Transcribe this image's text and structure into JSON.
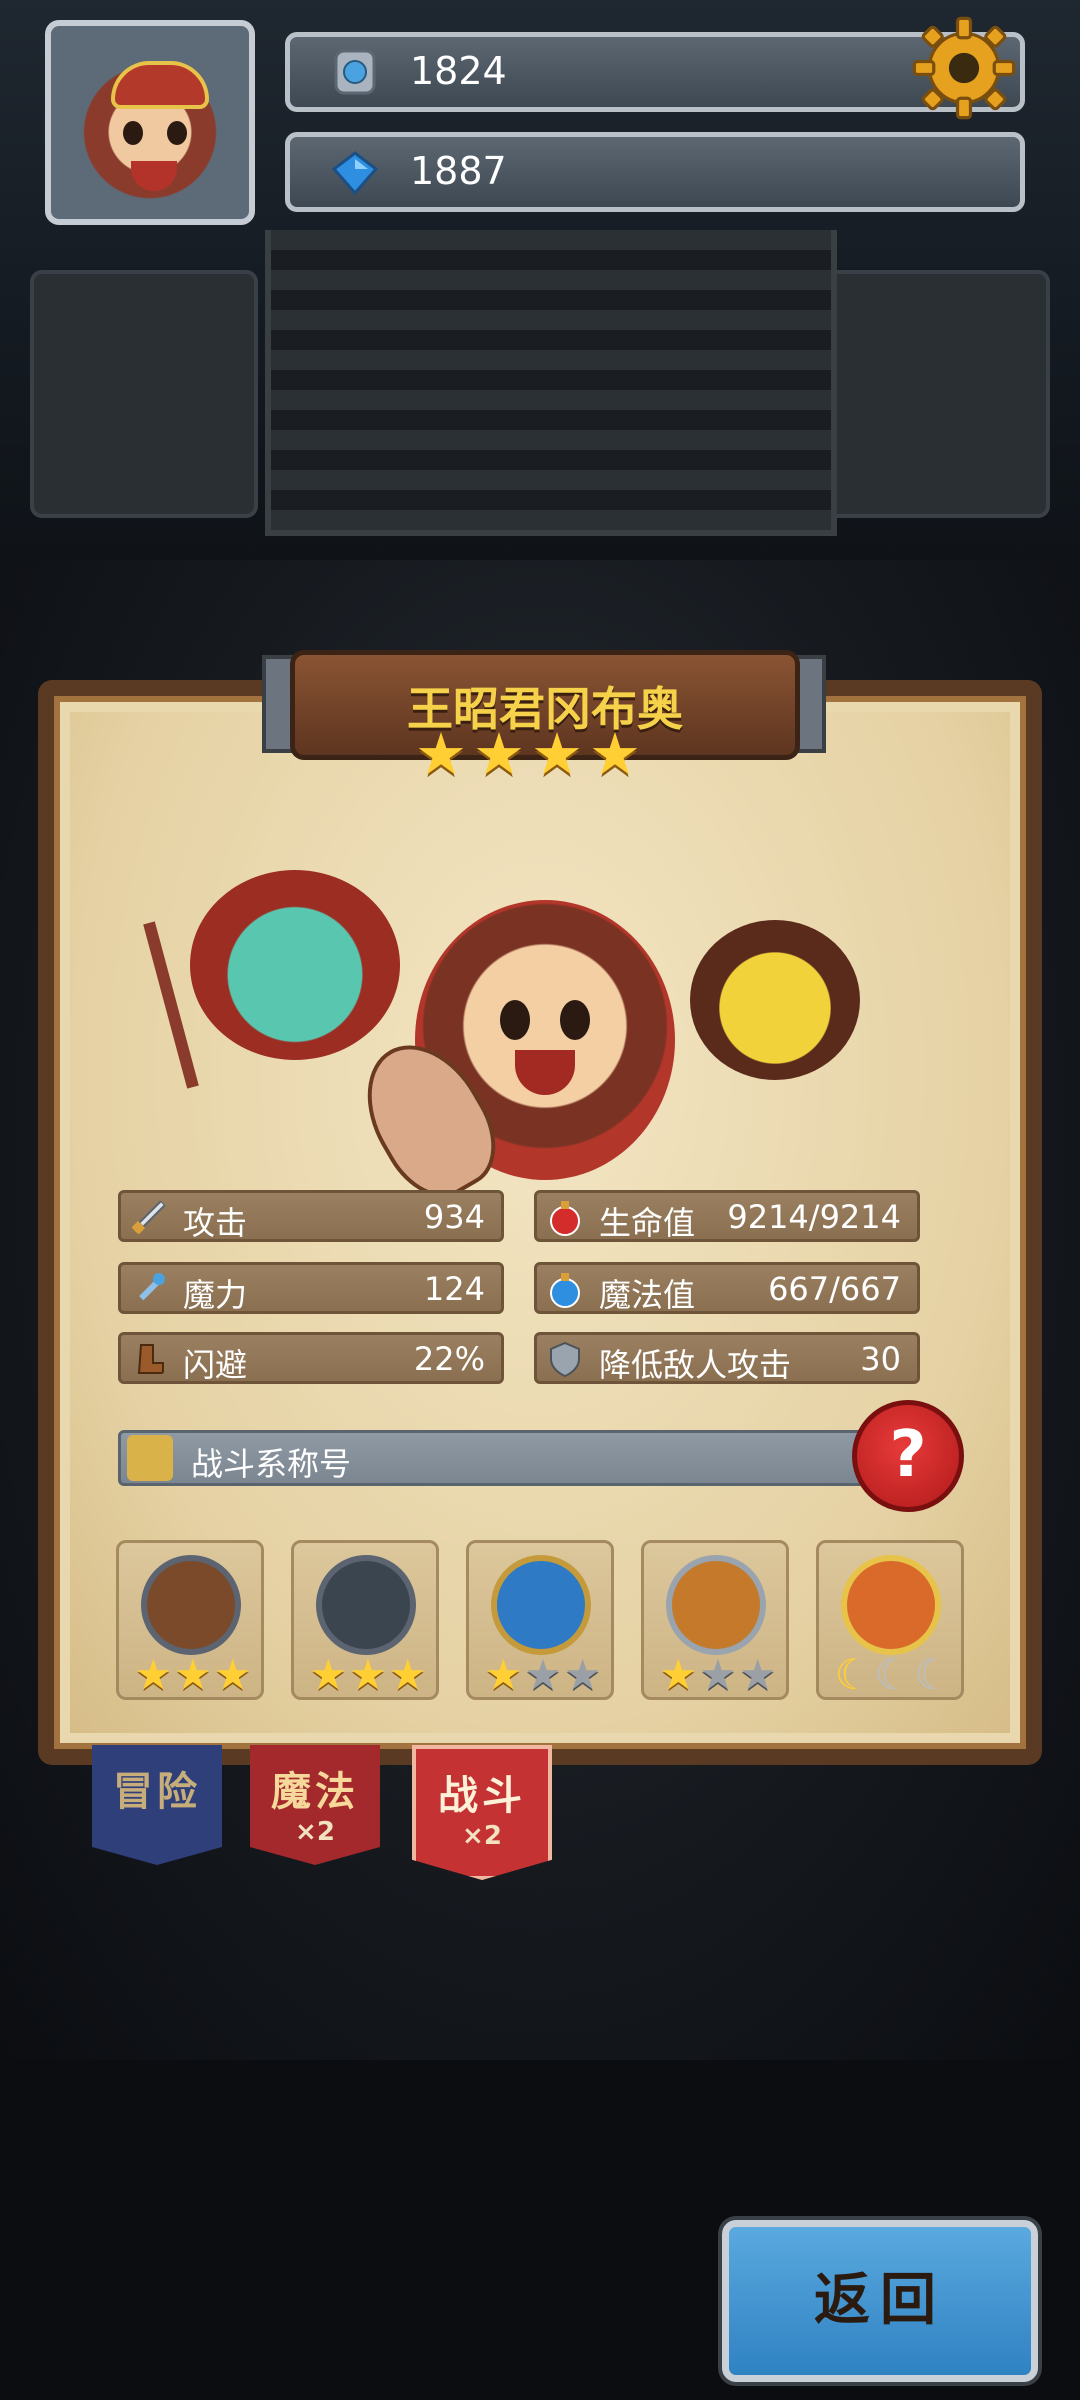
{
  "resources": {
    "silver_label": "1824",
    "gems_label": "1887",
    "silver_icon": "silver-coin-icon",
    "gem_icon": "blue-gem-icon"
  },
  "hero": {
    "name": "王昭君冈布奥",
    "stars": 4
  },
  "stats": [
    {
      "label": "攻击",
      "value": "934",
      "icon": "sword-icon"
    },
    {
      "label": "生命值",
      "value": "9214/9214",
      "icon": "red-potion-icon"
    },
    {
      "label": "魔力",
      "value": "124",
      "icon": "magic-wand-icon"
    },
    {
      "label": "魔法值",
      "value": "667/667",
      "icon": "blue-potion-icon"
    },
    {
      "label": "闪避",
      "value": "22%",
      "icon": "boot-icon"
    },
    {
      "label": "降低敌人攻击",
      "value": "30",
      "icon": "shield-icon"
    }
  ],
  "battle_title": {
    "label": "战斗系称号",
    "help": "?"
  },
  "badges": [
    {
      "icon": "dagger-badge-icon",
      "stars_on": 3,
      "stars_off": 0
    },
    {
      "icon": "spear-shield-badge-icon",
      "stars_on": 3,
      "stars_off": 0
    },
    {
      "icon": "blue-shield-badge-icon",
      "stars_on": 1,
      "stars_off": 2
    },
    {
      "icon": "laurel-sword-badge-icon",
      "stars_on": 1,
      "stars_off": 2
    },
    {
      "icon": "dragon-crown-badge-icon",
      "moons_on": 1,
      "moons_off": 2
    }
  ],
  "tabs": [
    {
      "label": "冒险",
      "multiplier": ""
    },
    {
      "label": "魔法",
      "multiplier": "×2"
    },
    {
      "label": "战斗",
      "multiplier": "×2"
    }
  ],
  "back_label": "返回"
}
